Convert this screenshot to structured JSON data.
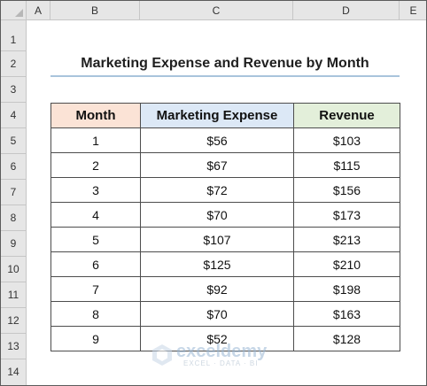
{
  "columns": [
    "A",
    "B",
    "C",
    "D",
    "E"
  ],
  "rows": [
    "1",
    "2",
    "3",
    "4",
    "5",
    "6",
    "7",
    "8",
    "9",
    "10",
    "11",
    "12",
    "13",
    "14"
  ],
  "title": "Marketing Expense and Revenue by Month",
  "table": {
    "headers": [
      "Month",
      "Marketing Expense",
      "Revenue"
    ],
    "rows": [
      [
        "1",
        "$56",
        "$103"
      ],
      [
        "2",
        "$67",
        "$115"
      ],
      [
        "3",
        "$72",
        "$156"
      ],
      [
        "4",
        "$70",
        "$173"
      ],
      [
        "5",
        "$107",
        "$213"
      ],
      [
        "6",
        "$125",
        "$210"
      ],
      [
        "7",
        "$92",
        "$198"
      ],
      [
        "8",
        "$70",
        "$163"
      ],
      [
        "9",
        "$52",
        "$128"
      ]
    ]
  },
  "watermark": {
    "name": "exceldemy",
    "tagline": "EXCEL · DATA · BI"
  },
  "colors": {
    "month_header": "#fbe3d6",
    "expense_header": "#dce8f6",
    "revenue_header": "#e3efda",
    "title_underline": "#a9c4dc"
  }
}
